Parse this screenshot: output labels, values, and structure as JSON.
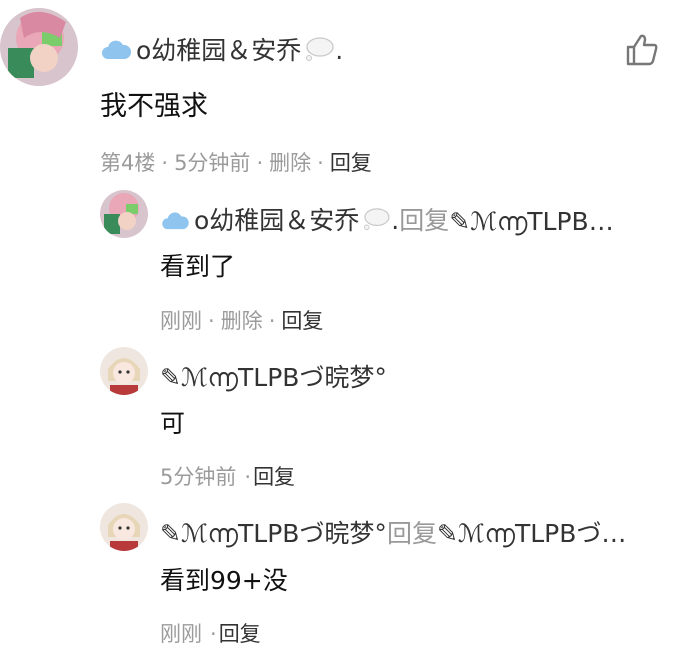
{
  "colors": {
    "name": "#333333",
    "content": "#111111",
    "meta": "#9b9b9b",
    "reply_link": "#333333"
  },
  "main": {
    "username": "o幼稚园＆安乔",
    "username_suffix": ".",
    "content": "我不强求",
    "floor": "第4楼",
    "time": "5分钟前",
    "delete": "删除",
    "reply": "回复",
    "sep": "·"
  },
  "replies": [
    {
      "username": "o幼稚园＆安乔",
      "username_suffix": ".",
      "reply_word": "回复",
      "target": "✎ℳ൬TLPB…",
      "content": "看到了",
      "time": "刚刚",
      "delete": "删除",
      "reply": "回复"
    },
    {
      "username": "✎ℳ൬TLPBづ晥梦°",
      "content": "可",
      "time": "5分钟前",
      "reply": "回复"
    },
    {
      "username": "✎ℳ൬TLPBづ晥梦°",
      "reply_word": "回复",
      "target": "✎ℳ൬TLPBづ…",
      "content": "看到99+没",
      "time": "刚刚",
      "reply": "回复"
    }
  ],
  "icons": {
    "like": "thumbs-up-icon",
    "cloud": "cloud-emoji-icon",
    "bubble": "thought-bubble-icon"
  }
}
